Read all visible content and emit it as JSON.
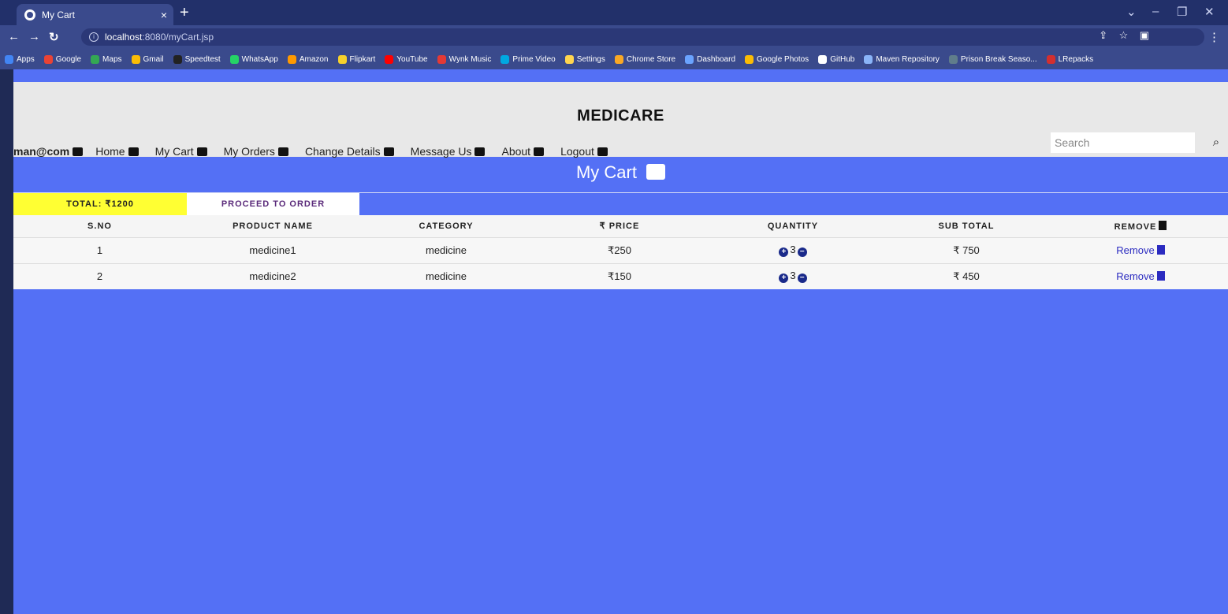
{
  "browser": {
    "tab_title": "My Cart",
    "tab_close": "×",
    "new_tab": "+",
    "url_host": "localhost",
    "url_path": ":8080/myCart.jsp",
    "bookmarks": [
      "Apps",
      "Google",
      "Maps",
      "Gmail",
      "Speedtest",
      "WhatsApp",
      "Amazon",
      "Flipkart",
      "YouTube",
      "Wynk Music",
      "Prime Video",
      "Settings",
      "Chrome Store",
      "Dashboard",
      "Google Photos",
      "GitHub",
      "Maven Repository",
      "Prison Break Seaso...",
      "LRepacks"
    ],
    "bookmark_colors": [
      "#4285f4",
      "#ea4335",
      "#34a853",
      "#fbbc05",
      "#222222",
      "#25d366",
      "#ff9900",
      "#f7d12b",
      "#ff0000",
      "#e53935",
      "#00a8e1",
      "#ffd54f",
      "#f9a825",
      "#6aa3ff",
      "#fbbc05",
      "#ffffff",
      "#8ab4f8",
      "#607d8b",
      "#d32f2f"
    ]
  },
  "site": {
    "brand": "MEDICARE",
    "user": "man@com",
    "nav": [
      "Home",
      "My Cart",
      "My Orders",
      "Change Details",
      "Message Us",
      "About",
      "Logout"
    ],
    "search_placeholder": "Search"
  },
  "cart": {
    "title": "My Cart",
    "total_label": "TOTAL: ₹1200",
    "proceed_label": "PROCEED TO ORDER",
    "columns": [
      "S.NO",
      "PRODUCT NAME",
      "CATEGORY",
      "₹ PRICE",
      "QUANTITY",
      "SUB TOTAL",
      "REMOVE"
    ],
    "rows": [
      {
        "sno": "1",
        "name": "medicine1",
        "category": "medicine",
        "price": "₹250",
        "qty": "3",
        "subtotal": "₹ 750",
        "remove": "Remove"
      },
      {
        "sno": "2",
        "name": "medicine2",
        "category": "medicine",
        "price": "₹150",
        "qty": "3",
        "subtotal": "₹ 450",
        "remove": "Remove"
      }
    ]
  }
}
